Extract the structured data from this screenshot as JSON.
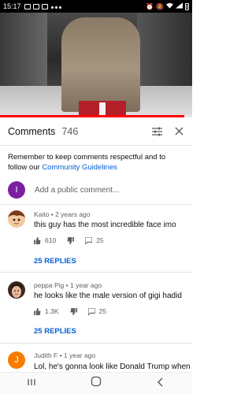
{
  "status_bar": {
    "time": "15:17"
  },
  "comments": {
    "title": "Comments",
    "count": "746",
    "guidelines_text": "Remember to keep comments respectful and to follow our ",
    "guidelines_link": "Community Guidelines",
    "add_placeholder": "Add a public comment...",
    "user_initial": "I",
    "user_color": "#7b1fa2",
    "items": [
      {
        "author": "Kaito",
        "age": "2 years ago",
        "text": "this guy has the most incredible face imo",
        "likes": "610",
        "replies_count": "25",
        "replies_label": "25 REPLIES"
      },
      {
        "author": "peppa Pig",
        "age": "1 year ago",
        "text": "he looks like the male version of gigi hadid",
        "likes": "1.3K",
        "replies_count": "25",
        "replies_label": "25 REPLIES"
      },
      {
        "author": "Judith F",
        "age": "1 year ago",
        "text": "Lol,  he's gonna look like Donald Trump when",
        "initial": "J",
        "color": "#f57c00"
      }
    ]
  },
  "accent": {
    "link": "#065fd4",
    "progress": "#ff0000"
  }
}
